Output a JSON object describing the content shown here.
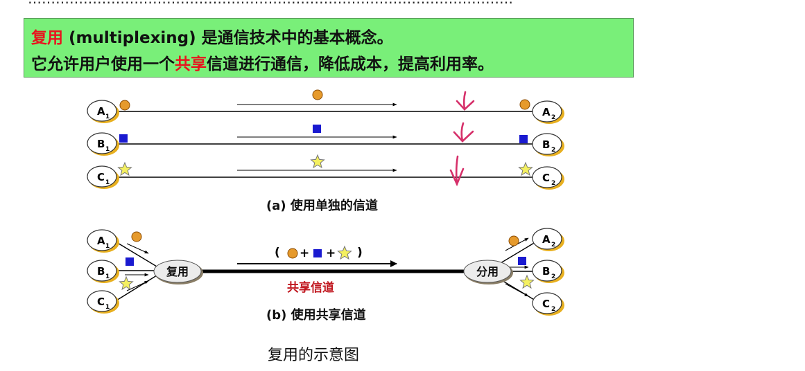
{
  "top_partial_text": "……………………………………………………………………………………………",
  "definition": {
    "line1_term": "复用",
    "line1_rest": " (multiplexing) 是通信技术中的基本概念。",
    "line2_part1": "它允许用户使用一个",
    "line2_highlight": "共享",
    "line2_part2": "信道进行通信，降低成本，提高利用率。"
  },
  "diagram_a": {
    "left_nodes": [
      {
        "letter": "A",
        "sub": "1"
      },
      {
        "letter": "B",
        "sub": "1"
      },
      {
        "letter": "C",
        "sub": "1"
      }
    ],
    "right_nodes": [
      {
        "letter": "A",
        "sub": "2"
      },
      {
        "letter": "B",
        "sub": "2"
      },
      {
        "letter": "C",
        "sub": "2"
      }
    ],
    "caption": "(a) 使用单独的信道"
  },
  "diagram_b": {
    "left_nodes": [
      {
        "letter": "A",
        "sub": "1"
      },
      {
        "letter": "B",
        "sub": "1"
      },
      {
        "letter": "C",
        "sub": "1"
      }
    ],
    "right_nodes": [
      {
        "letter": "A",
        "sub": "2"
      },
      {
        "letter": "B",
        "sub": "2"
      },
      {
        "letter": "C",
        "sub": "2"
      }
    ],
    "mux_label": "复用",
    "demux_label": "分用",
    "combined_open": "(",
    "combined_plus1": "+",
    "combined_plus2": "+",
    "combined_close": ")",
    "shared_label": "共享信道",
    "caption": "(b) 使用共享信道"
  },
  "figure_caption": "复用的示意图",
  "colors": {
    "banner_bg": "#79ef79",
    "highlight_red": "#e8141e",
    "shared_label": "#c0161e",
    "circle_orange": "#e69a2c",
    "square_blue": "#1a1ad0",
    "star_yellow": "#f4f060",
    "annotation_pink": "#d6306a"
  },
  "icons": [
    "orange-circle-icon",
    "blue-square-icon",
    "yellow-star-icon",
    "down-arrow-annotation-icon"
  ]
}
